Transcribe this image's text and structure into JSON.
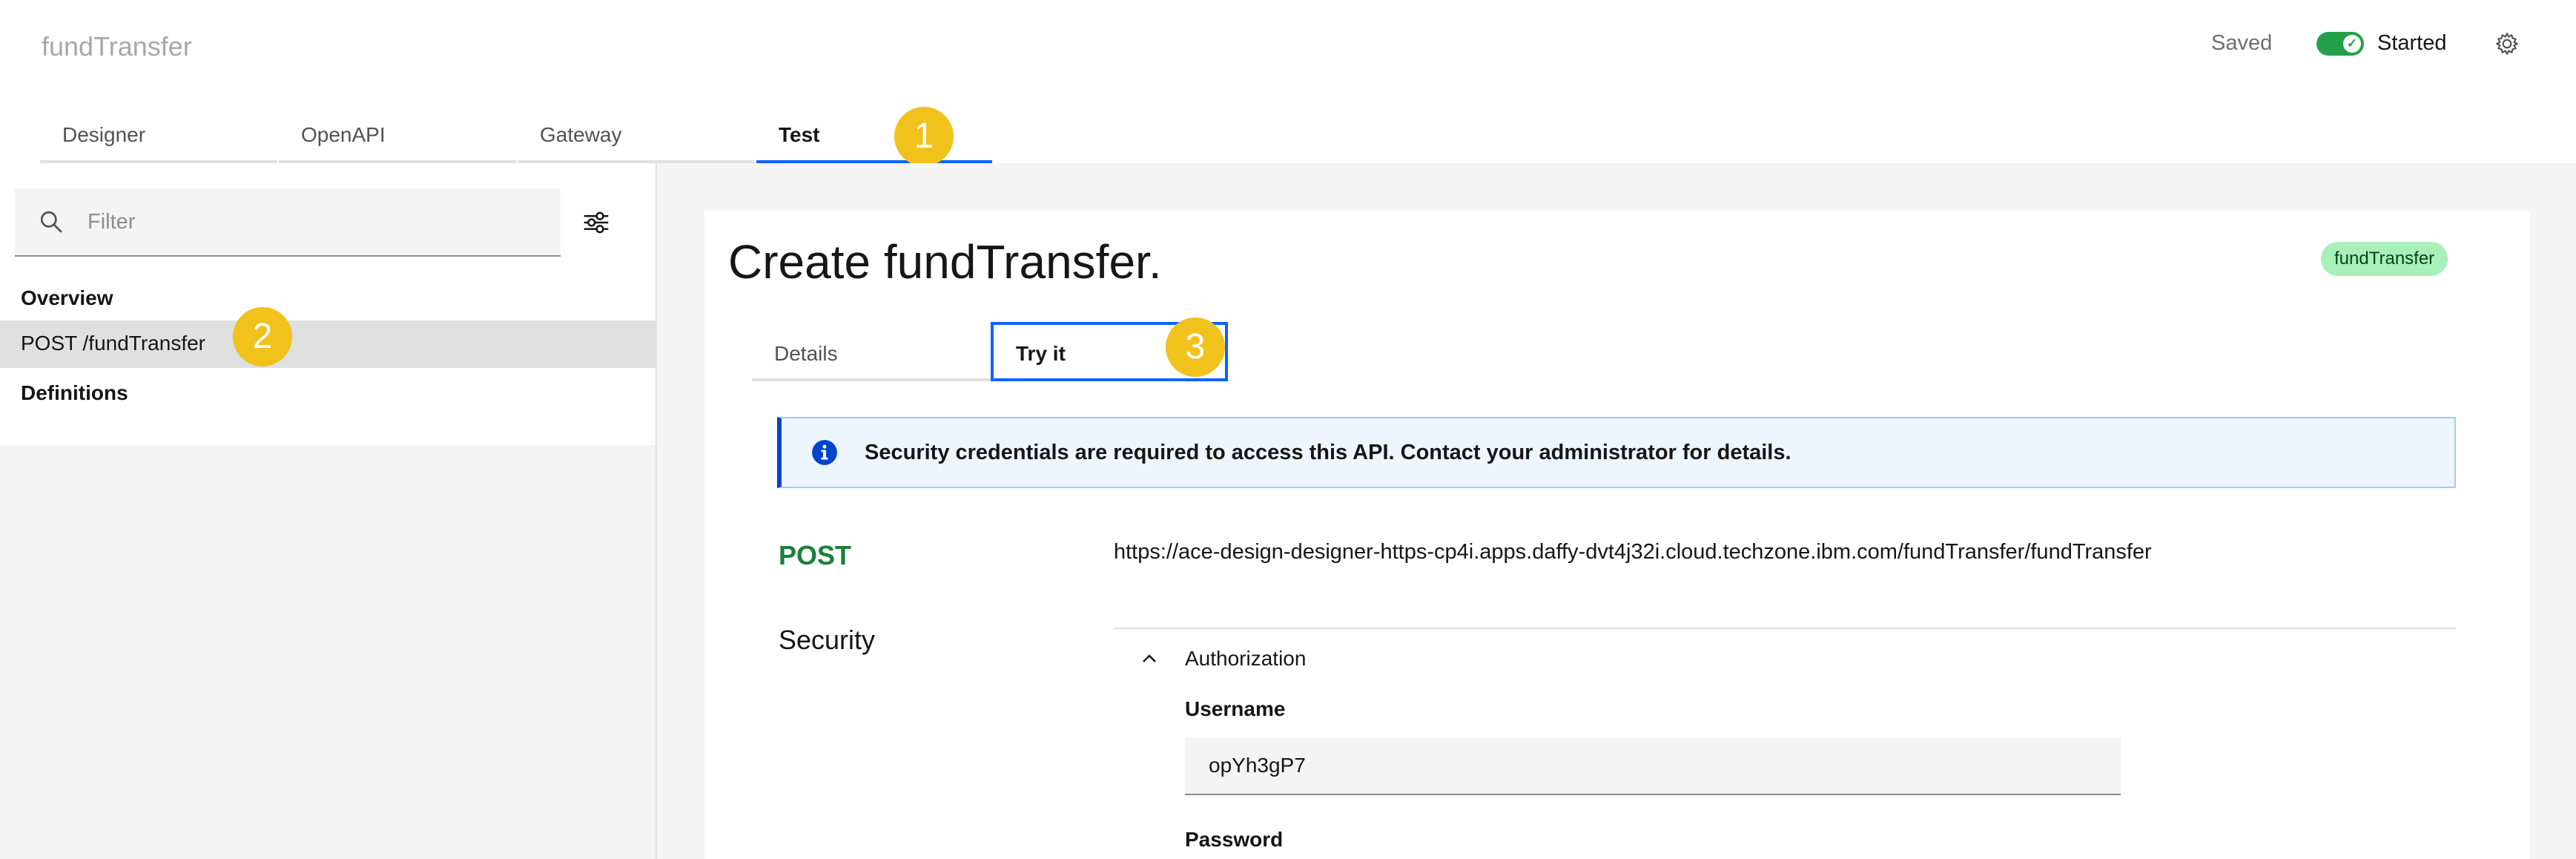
{
  "header": {
    "app_title": "fundTransfer",
    "save_status": "Saved",
    "run_state": "Started"
  },
  "tabs": [
    {
      "label": "Designer"
    },
    {
      "label": "OpenAPI"
    },
    {
      "label": "Gateway"
    },
    {
      "label": "Test",
      "active": true
    }
  ],
  "callouts": [
    "1",
    "2",
    "3"
  ],
  "sidebar": {
    "filter_placeholder": "Filter",
    "overview_label": "Overview",
    "operation_label": "POST /fundTransfer",
    "definitions_label": "Definitions"
  },
  "main": {
    "title": "Create fundTransfer.",
    "tag": "fundTransfer",
    "subtabs": [
      {
        "label": "Details"
      },
      {
        "label": "Try it",
        "active": true
      }
    ],
    "notice": "Security credentials are required to access this API. Contact your administrator for details.",
    "method": "POST",
    "url": "https://ace-design-designer-https-cp4i.apps.daffy-dvt4j32i.cloud.techzone.ibm.com/fundTransfer/fundTransfer",
    "security_label": "Security",
    "authorization_label": "Authorization",
    "username_label": "Username",
    "username_value": "opYh3gP7",
    "password_label": "Password"
  },
  "colors": {
    "accent": "#0f62fe",
    "callout": "#f1c21b",
    "toggle_on": "#24a148",
    "method_post": "#198038",
    "tag_bg": "#a7f0ba"
  },
  "icons": [
    "gear-icon",
    "search-icon",
    "filter-settings-icon",
    "info-icon",
    "chevron-up-icon",
    "checkmark-icon"
  ]
}
